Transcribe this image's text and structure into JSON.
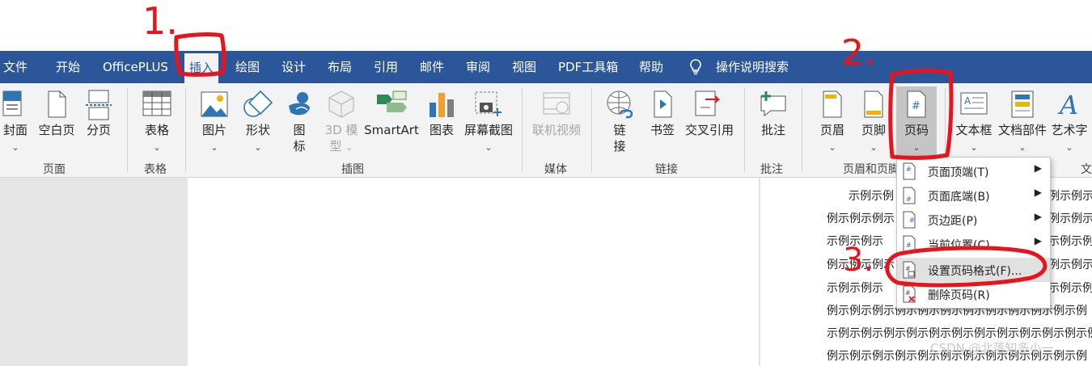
{
  "tabs": [
    "文件",
    "开始",
    "OfficePLUS",
    "插入",
    "绘图",
    "设计",
    "布局",
    "引用",
    "邮件",
    "审阅",
    "视图",
    "PDF工具箱",
    "帮助"
  ],
  "search_label": "操作说明搜索",
  "ribbon": {
    "pages": {
      "cover": "封面",
      "blank": "空白页",
      "break": "分页",
      "group": "页面"
    },
    "tables": {
      "table": "表格",
      "group": "表格"
    },
    "illustrations": {
      "picture": "图片",
      "shapes": "形状",
      "icons_1": "图",
      "icons_2": "标",
      "model3d_1": "3D 模",
      "model3d_2": "型",
      "smartart": "SmartArt",
      "chart": "图表",
      "screenshot": "屏幕截图",
      "group": "插图"
    },
    "media": {
      "video": "联机视频",
      "group": "媒体"
    },
    "links": {
      "link_1": "链",
      "link_2": "接",
      "bookmark": "书签",
      "crossref": "交叉引用",
      "group": "链接"
    },
    "comments": {
      "comment": "批注",
      "group": "批注"
    },
    "header_footer": {
      "header": "页眉",
      "footer": "页脚",
      "page_number": "页码",
      "group": "页眉和页脚"
    },
    "text": {
      "textbox": "文本框",
      "parts": "文档部件",
      "wordart": "艺术字",
      "group": "文"
    }
  },
  "menu": {
    "items": [
      "页面顶端(T)",
      "页面底端(B)",
      "页边距(P)",
      "当前位置(C)",
      "设置页码格式(F)...",
      "删除页码(R)"
    ]
  },
  "doc_lines": [
    "示例示例",
    "例示例示例示",
    "示例示例示",
    "例示例示例示",
    "示例示例示",
    "例示例示例示例示例示例示例示例示例示例示例示例",
    "示例示例示例示例示例示例示例示例示例示例示例示例",
    "例示例示例示例示例示例示例示例示例示例示例示例"
  ],
  "doc_right": [
    "例示例示",
    "例示例示",
    "示例示例",
    "例示例示",
    "示例示例"
  ],
  "annotations": [
    "1.",
    "2.",
    "3."
  ],
  "watermark": "CSDN @北落知多小一",
  "colors": {
    "tab_bar": "#2b579a",
    "ribbon": "#f3f3f3",
    "annotation": "#e8141c"
  }
}
